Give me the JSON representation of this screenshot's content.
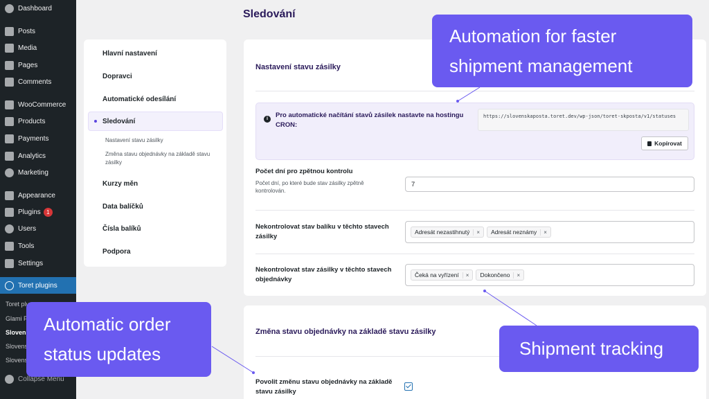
{
  "wp_menu": {
    "items": [
      {
        "label": "Dashboard",
        "icon": "dashboard-icon"
      },
      {
        "label": "Posts",
        "icon": "pin-icon"
      },
      {
        "label": "Media",
        "icon": "media-icon"
      },
      {
        "label": "Pages",
        "icon": "page-icon"
      },
      {
        "label": "Comments",
        "icon": "comment-icon"
      },
      {
        "label": "WooCommerce",
        "icon": "woo-icon"
      },
      {
        "label": "Products",
        "icon": "box-icon"
      },
      {
        "label": "Payments",
        "icon": "card-icon"
      },
      {
        "label": "Analytics",
        "icon": "bar-chart-icon"
      },
      {
        "label": "Marketing",
        "icon": "megaphone-icon"
      },
      {
        "label": "Appearance",
        "icon": "brush-icon"
      },
      {
        "label": "Plugins",
        "icon": "plug-icon",
        "badge": "1"
      },
      {
        "label": "Users",
        "icon": "user-icon"
      },
      {
        "label": "Tools",
        "icon": "wrench-icon"
      },
      {
        "label": "Settings",
        "icon": "settings-icon"
      },
      {
        "label": "Toret plugins",
        "icon": "toret-icon"
      }
    ],
    "submenu": [
      "Toret plu",
      "Glami P",
      "Slovens",
      "Slovens",
      "Slovens"
    ],
    "collapse_label": "Collapse Menu"
  },
  "page_title": "Sledování",
  "settings_nav": {
    "items": [
      "Hlavní nastavení",
      "Dopravci",
      "Automatické odesílání",
      "Sledování",
      "Kurzy měn",
      "Data balíčků",
      "Čísla balíků",
      "Podpora"
    ],
    "subitems": [
      "Nastavení stavu zásilky",
      "Změna stavu objednávky na základě stavu zásilky"
    ]
  },
  "section1": {
    "title": "Nastavení stavu zásilky",
    "info_text": "Pro automatické načítání stavů zásilek nastavte na hostingu CRON:",
    "url": "https://slovenskaposta.toret.dev/wp-json/toret-skposta/v1/statuses",
    "copy_label": "Kopírovat",
    "days_label": "Počet dní pro zpětnou kontrolu",
    "days_desc": "Počet dní, po které bude stav zásilky zpětně kontrolován.",
    "days_value": "7",
    "parcel_label": "Nekontrolovat stav balíku v těchto stavech zásilky",
    "parcel_tags": [
      "Adresát nezastihnutý",
      "Adresát neznámy"
    ],
    "order_label": "Nekontrolovat stav zásilky v těchto stavech objednávky",
    "order_tags": [
      "Čeká na vyřízení",
      "Dokončeno"
    ],
    "tag_remove": "×"
  },
  "section2": {
    "title": "Změna stavu objednávky na základě stavu zásilky",
    "enable_label": "Povolit změnu stavu objednávky na základě stavu zásilky"
  },
  "callouts": {
    "automation": [
      "Automation for faster",
      "shipment management"
    ],
    "order_status": [
      "Automatic order",
      "status updates"
    ],
    "tracking": [
      "Shipment tracking"
    ]
  },
  "colors": {
    "accent": "#6a5af0",
    "wp_sidebar": "#1d2327",
    "wp_active": "#2271b1",
    "title": "#2a1a5a"
  }
}
